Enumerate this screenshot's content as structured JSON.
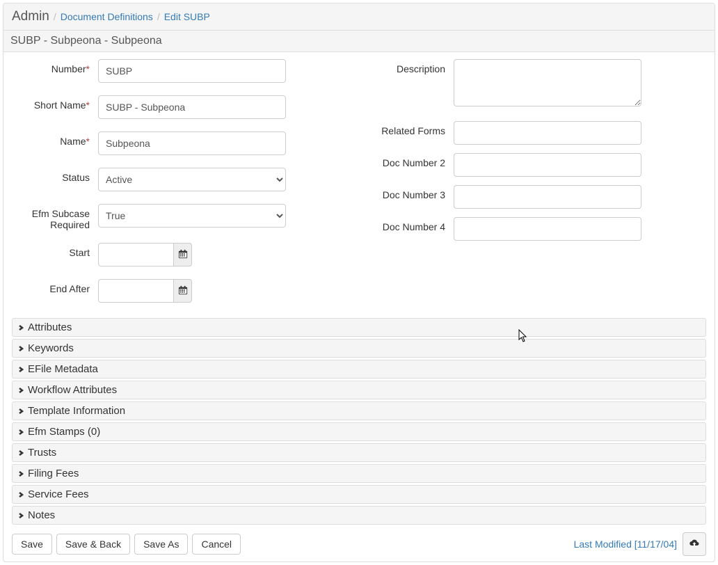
{
  "breadcrumb": {
    "admin": "Admin",
    "doc_def": "Document Definitions",
    "edit": "Edit SUBP"
  },
  "subheader": "SUBP - Subpeona - Subpeona",
  "left": {
    "number_label": "Number",
    "number_value": "SUBP",
    "shortname_label": "Short Name",
    "shortname_value": "SUBP - Subpeona",
    "name_label": "Name",
    "name_value": "Subpeona",
    "status_label": "Status",
    "status_value": "Active",
    "efm_label_1": "Efm Subcase",
    "efm_label_2": "Required",
    "efm_value": "True",
    "start_label": "Start",
    "start_value": "",
    "endafter_label": "End After",
    "endafter_value": ""
  },
  "right": {
    "description_label": "Description",
    "description_value": "",
    "related_forms_label": "Related Forms",
    "related_forms_value": "",
    "docnumber2_label": "Doc Number 2",
    "docnumber2_value": "",
    "docnumber3_label": "Doc Number 3",
    "docnumber3_value": "",
    "docnumber4_label": "Doc Number 4",
    "docnumber4_value": ""
  },
  "accordions": [
    "Attributes",
    "Keywords",
    "EFile Metadata",
    "Workflow Attributes",
    "Template Information",
    "Efm Stamps (0)",
    "Trusts",
    "Filing Fees",
    "Service Fees",
    "Notes"
  ],
  "footer": {
    "save": "Save",
    "save_back": "Save & Back",
    "save_as": "Save As",
    "cancel": "Cancel",
    "last_modified": "Last Modified [11/17/04]"
  }
}
